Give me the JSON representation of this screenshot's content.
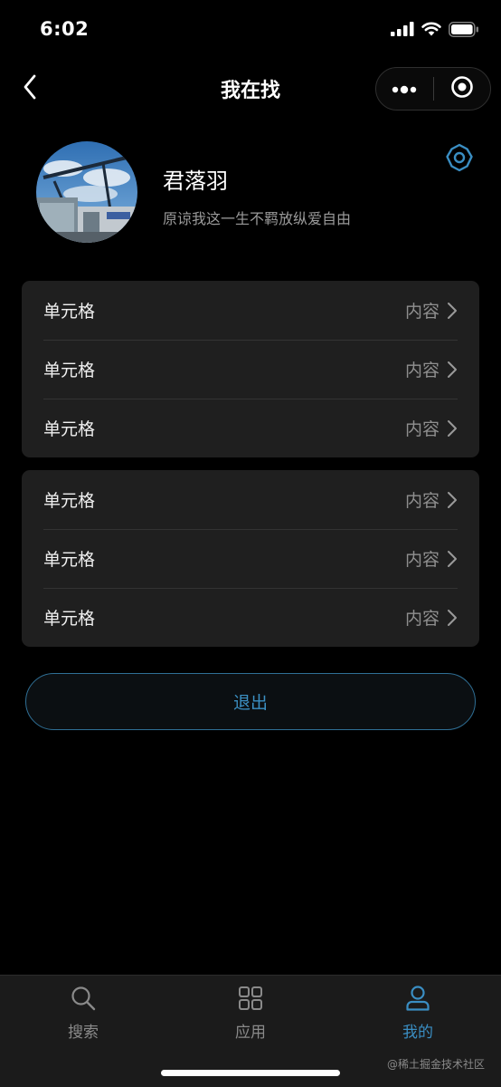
{
  "status_bar": {
    "time": "6:02"
  },
  "nav": {
    "title": "我在找"
  },
  "profile": {
    "name": "君落羽",
    "bio": "原谅我这一生不羁放纵爱自由"
  },
  "groups": [
    {
      "items": [
        {
          "title": "单元格",
          "value": "内容"
        },
        {
          "title": "单元格",
          "value": "内容"
        },
        {
          "title": "单元格",
          "value": "内容"
        }
      ]
    },
    {
      "items": [
        {
          "title": "单元格",
          "value": "内容"
        },
        {
          "title": "单元格",
          "value": "内容"
        },
        {
          "title": "单元格",
          "value": "内容"
        }
      ]
    }
  ],
  "logout": {
    "label": "退出"
  },
  "tabbar": {
    "tabs": [
      {
        "label": "搜索",
        "icon": "search-icon",
        "active": false
      },
      {
        "label": "应用",
        "icon": "apps-grid-icon",
        "active": false
      },
      {
        "label": "我的",
        "icon": "user-icon",
        "active": true
      }
    ]
  },
  "watermark": "@稀土掘金技术社区",
  "colors": {
    "accent": "#3a8ec3",
    "background": "#000000",
    "cell_bg": "#1f1f1f"
  }
}
